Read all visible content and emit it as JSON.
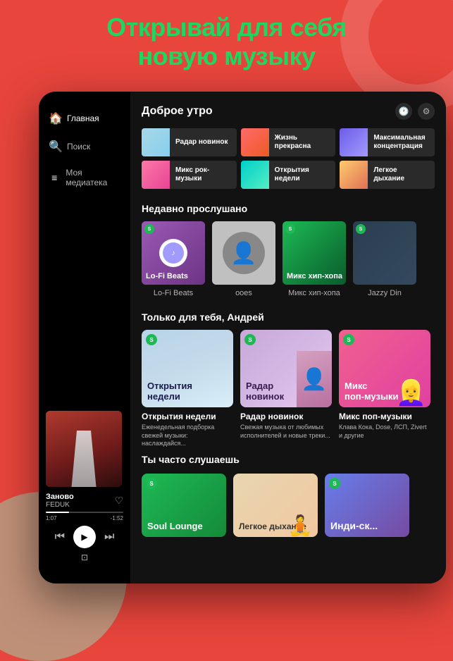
{
  "app": {
    "header_line1": "Открывай для себя",
    "header_line2": "новую музыку"
  },
  "sidebar": {
    "items": [
      {
        "id": "home",
        "label": "Главная",
        "icon": "⌂",
        "active": true
      },
      {
        "id": "search",
        "label": "Поиск",
        "icon": "🔍",
        "active": false
      },
      {
        "id": "library",
        "label": "Моя медиатека",
        "icon": "≡",
        "active": false
      }
    ]
  },
  "player": {
    "song": "Заново",
    "artist": "FEDUK",
    "time_current": "1:07",
    "time_total": "-1:52",
    "progress_percent": 30
  },
  "main": {
    "greeting": "Доброе утро",
    "quick_picks": [
      {
        "label": "Радар новинок",
        "art": "qp-radar"
      },
      {
        "label": "Жизнь прекрасна",
        "art": "qp-life"
      },
      {
        "label": "Максимальная концентрация",
        "art": "qp-max"
      },
      {
        "label": "Микс рок-музыки",
        "art": "qp-mix-rock"
      },
      {
        "label": "Открытия недели",
        "art": "qp-open"
      },
      {
        "label": "Легкое дыхание",
        "art": "qp-easy"
      }
    ],
    "recently_title": "Недавно прослушано",
    "recently": [
      {
        "label": "Lo-Fi Beats",
        "art": "art-lofi"
      },
      {
        "label": "ooes",
        "art": "art-ooes"
      },
      {
        "label": "Микс хип-хопа",
        "art": "art-hiphop"
      },
      {
        "label": "Jazzy Din",
        "art": "art-jazzy"
      }
    ],
    "for_you_title": "Только для тебя, Андрей",
    "for_you": [
      {
        "title": "Открытия недели",
        "desc": "Еженедельная подборка свежей музыки: наслаждайся...",
        "art": "art-discoveries",
        "overlay": "Открытия\nнедели"
      },
      {
        "title": "Радар новинок",
        "desc": "Свежая музыка от любимых исполнителей и новые треки...",
        "art": "art-radar",
        "overlay": "Радар\nновинок"
      },
      {
        "title": "Микс поп-музыки",
        "desc": "Клава Кока, Dose, ЛСП, Zivert и другие",
        "art": "art-pop",
        "overlay": "Микс\nпоп-музыки"
      }
    ],
    "often_title": "Ты часто слушаешь",
    "often": [
      {
        "label": "Soul Lounge",
        "art": "art-soul",
        "overlay": "Soul Lounge"
      },
      {
        "label": "Легкое дыхание",
        "art": "art-light",
        "overlay": "Легкое дыхание"
      },
      {
        "label": "Инди-ск...",
        "art": "art-indie",
        "overlay": "Инди-ск..."
      }
    ]
  }
}
